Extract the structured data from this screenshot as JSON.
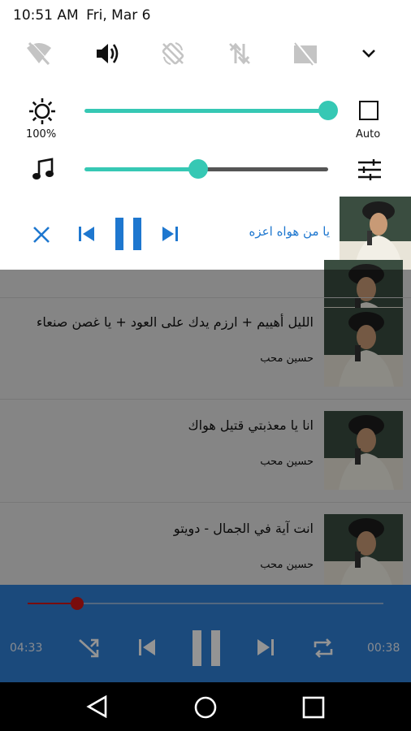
{
  "status_bar": {
    "time": "10:51 AM",
    "date": "Fri, Mar 6"
  },
  "quick_settings": {
    "tiles": [
      {
        "icon": "wifi-off-icon"
      },
      {
        "icon": "volume-icon"
      },
      {
        "icon": "auto-rotate-off-icon"
      },
      {
        "icon": "data-off-icon"
      },
      {
        "icon": "no-sim-icon"
      },
      {
        "icon": "expand-chevron-icon"
      }
    ],
    "brightness": {
      "label": "100%",
      "value": 1.0,
      "auto_label": "Auto"
    },
    "media_volume": {
      "value": 0.47
    }
  },
  "media_notification": {
    "title": "يا من هواه اعزه"
  },
  "songs": [
    {
      "title": "الليل أهييم + ارزم يدك على العود + يا غصن صنعاء",
      "artist": "حسين محب"
    },
    {
      "title": "انا يا معذبتي قتيل هواك",
      "artist": "حسين محب"
    },
    {
      "title": "انت آية في الجمال - دويتو",
      "artist": "حسين محب"
    }
  ],
  "player": {
    "elapsed": "04:33",
    "total": "00:38",
    "progress": 0.14
  },
  "colors": {
    "accent": "#36c8b4",
    "player_bg": "#2f80d6",
    "progress": "#d01818",
    "link": "#1e77cf"
  }
}
